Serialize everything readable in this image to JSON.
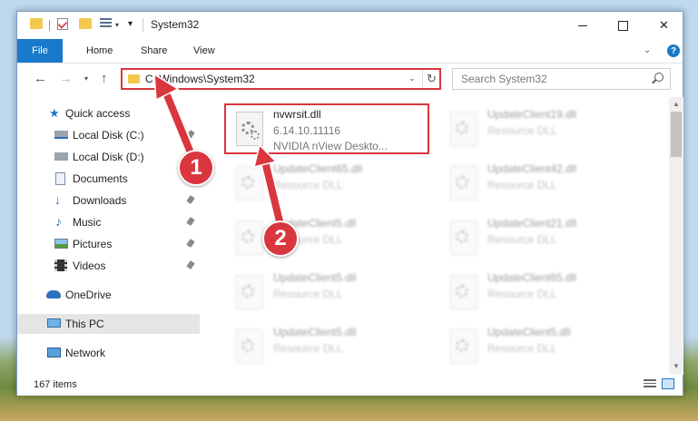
{
  "window": {
    "title": "System32",
    "minimize_icon": "minimize-icon",
    "maximize_icon": "maximize-icon",
    "close_icon": "close-icon"
  },
  "ribbon": {
    "tabs": [
      "File",
      "Home",
      "Share",
      "View"
    ],
    "expand_icon": "chevron-down-icon",
    "help_icon": "?"
  },
  "navigation": {
    "address": "C:\\Windows\\System32",
    "search_placeholder": "Search System32"
  },
  "sidebar": {
    "items": [
      {
        "label": "Quick access",
        "icon": "star-icon",
        "pinned": false
      },
      {
        "label": "Local Disk (C:)",
        "icon": "drive-icon",
        "pinned": true
      },
      {
        "label": "Local Disk (D:)",
        "icon": "drive-icon",
        "pinned": false
      },
      {
        "label": "Documents",
        "icon": "documents-icon",
        "pinned": true
      },
      {
        "label": "Downloads",
        "icon": "download-icon",
        "pinned": true
      },
      {
        "label": "Music",
        "icon": "music-icon",
        "pinned": true
      },
      {
        "label": "Pictures",
        "icon": "pictures-icon",
        "pinned": true
      },
      {
        "label": "Videos",
        "icon": "video-icon",
        "pinned": true
      },
      {
        "label": "OneDrive",
        "icon": "cloud-icon",
        "pinned": false
      },
      {
        "label": "This PC",
        "icon": "computer-icon",
        "pinned": false,
        "selected": true
      },
      {
        "label": "Network",
        "icon": "network-icon",
        "pinned": false
      }
    ]
  },
  "files": {
    "selected": {
      "name": "nvwrsit.dll",
      "version": "6.14.10.11116",
      "description": "NVIDIA nView Deskto..."
    },
    "items": [
      {
        "name": "UpdateClient19.dll",
        "type": "Resource DLL"
      },
      {
        "name": "UpdateClient65.dll",
        "type": "Resource DLL"
      },
      {
        "name": "UpdateClient42.dll",
        "type": "Resource DLL"
      },
      {
        "name": "UpdateClient5.dll",
        "type": "Resource DLL"
      },
      {
        "name": "UpdateClient21.dll",
        "type": "Resource DLL"
      },
      {
        "name": "UpdateClient5.dll",
        "type": "Resource DLL"
      },
      {
        "name": "UpdateClient65.dll",
        "type": "Resource DLL"
      },
      {
        "name": "UpdateClient5.dll",
        "type": "Resource DLL"
      },
      {
        "name": "UpdateClient5.dll",
        "type": "Resource DLL"
      }
    ]
  },
  "status": {
    "item_count": "167 items"
  },
  "annotations": {
    "step1": "1",
    "step2": "2",
    "highlight_color": "#d9363e"
  },
  "colors": {
    "accent": "#1979ca",
    "folder": "#f2c94c"
  }
}
